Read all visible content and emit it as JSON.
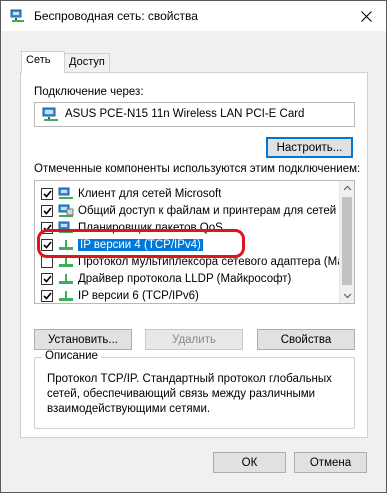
{
  "window": {
    "title": "Беспроводная сеть: свойства"
  },
  "tabs": [
    {
      "label": "Сеть",
      "active": true
    },
    {
      "label": "Доступ",
      "active": false
    }
  ],
  "connect_using": {
    "label": "Подключение через:",
    "adapter_name": "ASUS PCE-N15 11n Wireless LAN PCI-E Card",
    "configure_button": "Настроить..."
  },
  "components": {
    "label": "Отмеченные компоненты используются этим подключением:",
    "items": [
      {
        "label": "Клиент для сетей Microsoft",
        "checked": true,
        "icon": "network-client-icon"
      },
      {
        "label": "Общий доступ к файлам и принтерам для сетей Mi",
        "checked": true,
        "icon": "file-sharing-icon"
      },
      {
        "label": "Планировщик пакетов QoS",
        "checked": true,
        "icon": "qos-scheduler-icon"
      },
      {
        "label": "IP версии 4 (TCP/IPv4)",
        "checked": true,
        "icon": "protocol-icon",
        "selected": true
      },
      {
        "label": "Протокол мультиплексора сетевого адаптера (Ма",
        "checked": false,
        "icon": "protocol-icon"
      },
      {
        "label": "Драйвер протокола LLDP (Майкрософт)",
        "checked": true,
        "icon": "protocol-icon"
      },
      {
        "label": "IP версии 6 (TCP/IPv6)",
        "checked": true,
        "icon": "protocol-icon"
      }
    ]
  },
  "actions": {
    "install": "Установить...",
    "uninstall": "Удалить",
    "properties": "Свойства"
  },
  "description": {
    "title": "Описание",
    "text": "Протокол TCP/IP. Стандартный протокол глобальных сетей, обеспечивающий связь между различными взаимодействующими сетями."
  },
  "footer": {
    "ok": "ОК",
    "cancel": "Отмена"
  },
  "colors": {
    "selection": "#0078d7",
    "highlight_ring": "#e0141e",
    "window_bg": "#f0f0f0"
  }
}
